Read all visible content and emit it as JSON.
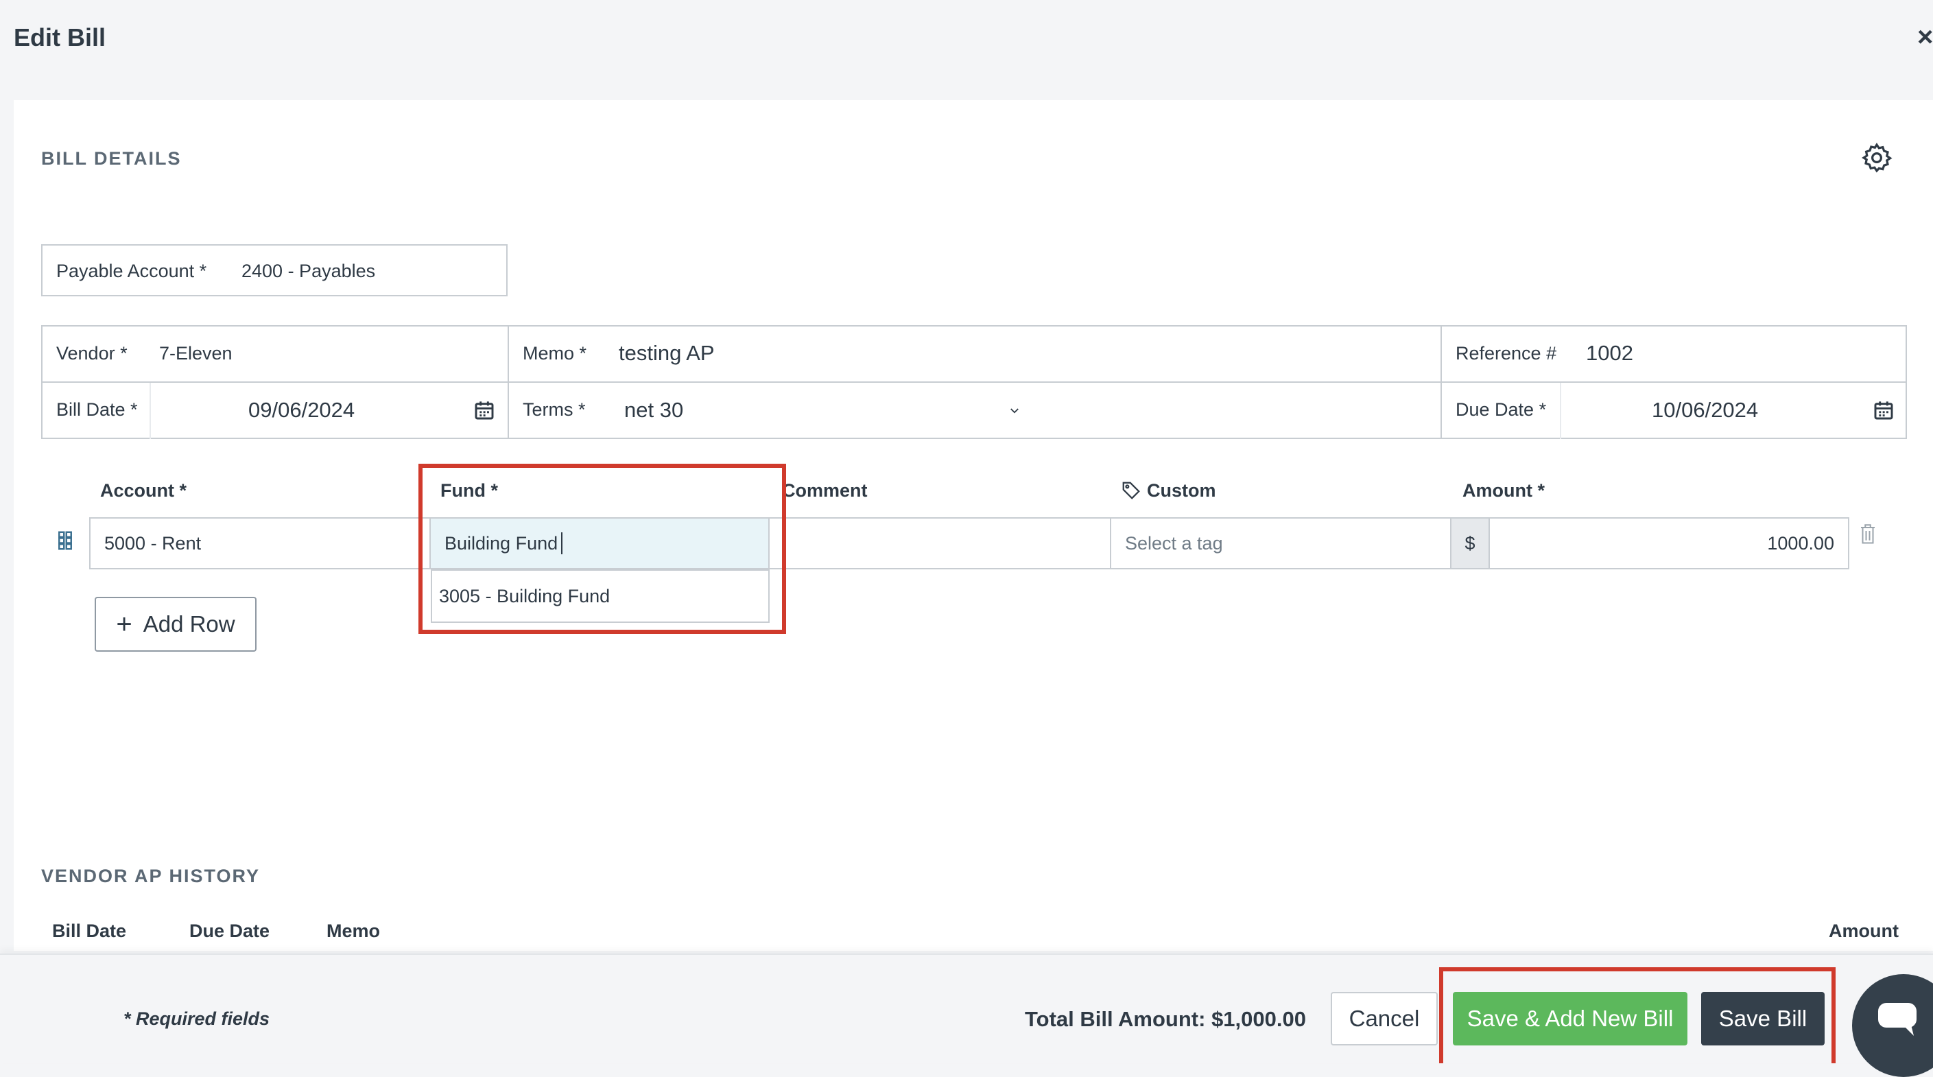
{
  "modal": {
    "title": "Edit Bill",
    "close_glyph": "×"
  },
  "bill_details": {
    "heading": "BILL DETAILS",
    "payable_account": {
      "label": "Payable Account *",
      "value": "2400 - Payables"
    },
    "vendor": {
      "label": "Vendor *",
      "value": "7-Eleven"
    },
    "memo": {
      "label": "Memo *",
      "value": "testing AP"
    },
    "reference": {
      "label": "Reference #",
      "value": "1002"
    },
    "bill_date": {
      "label": "Bill Date *",
      "value": "09/06/2024"
    },
    "terms": {
      "label": "Terms *",
      "value": "net 30"
    },
    "due_date": {
      "label": "Due Date *",
      "value": "10/06/2024"
    }
  },
  "line_items": {
    "headers": {
      "account": "Account *",
      "fund": "Fund *",
      "comment": "Comment",
      "custom": "Custom",
      "amount": "Amount *"
    },
    "row": {
      "account": "5000 - Rent",
      "fund_input": "Building Fund",
      "custom_placeholder": "Select a tag",
      "currency": "$",
      "amount": "1000.00"
    },
    "fund_dropdown_option": "3005 - Building Fund",
    "add_row_label": "Add Row",
    "add_row_glyph": "+"
  },
  "vendor_history": {
    "heading": "VENDOR AP HISTORY",
    "columns": [
      "Bill Date",
      "Due Date",
      "Memo",
      "Amount"
    ]
  },
  "footer": {
    "required_note": "* Required fields",
    "total_label": "Total Bill Amount: $1,000.00",
    "cancel_label": "Cancel",
    "save_add_new_label": "Save & Add New Bill",
    "save_label": "Save Bill"
  },
  "colors": {
    "green": "#5cb85c",
    "dark": "#34404b",
    "highlight": "#d03a2c",
    "input_focus": "#e8f4f8"
  }
}
